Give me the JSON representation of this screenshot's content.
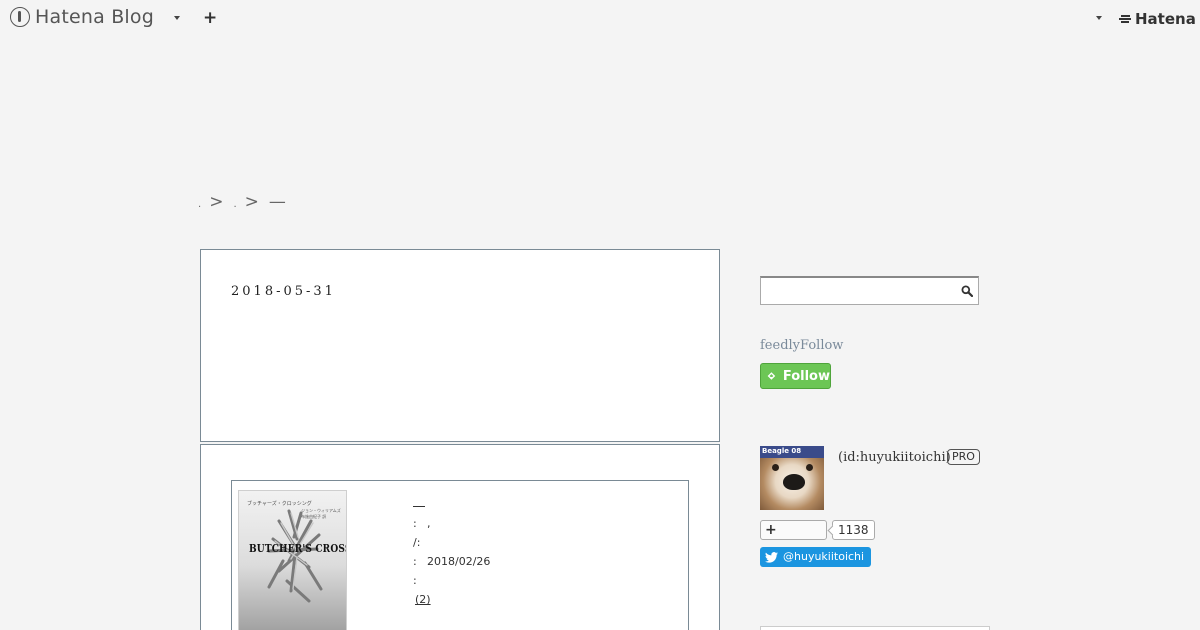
{
  "topbar": {
    "logo_text": "Hatena Blog",
    "hatena_text": "Hatena"
  },
  "breadcrumb": {
    "sep1": ">",
    "sep2": ">",
    "current": "—"
  },
  "entry": {
    "date": "2018-05-31"
  },
  "book": {
    "cover_top": "ブッチャーズ・クロッシング",
    "cover_author": "ジョン・ウィリアムズ",
    "cover_translator": "布施由紀子 訳",
    "cover_title": "BUTCHER'S CROSSING",
    "rows": [
      {
        "label": ":",
        "value": ","
      },
      {
        "label": "/:",
        "value": ""
      },
      {
        "label": ":",
        "value": "2018/02/26"
      },
      {
        "label": ":",
        "value": ""
      }
    ],
    "review": "(2)"
  },
  "sidebar": {
    "search_placeholder": "",
    "feedly_title": "feedlyFollow",
    "feedly_button": "Follow",
    "profile_id": "(id:huyukiitoichi)",
    "pro_badge": "PRO",
    "reader_count": "1138",
    "twitter_button": "@huyukiitoichi",
    "avatar_badge": "Beagle 08"
  },
  "colors": {
    "background": "#f4f4f4",
    "feedly_green": "#6cc655",
    "twitter_blue": "#1b95e0",
    "box_border": "#7a8a95"
  }
}
